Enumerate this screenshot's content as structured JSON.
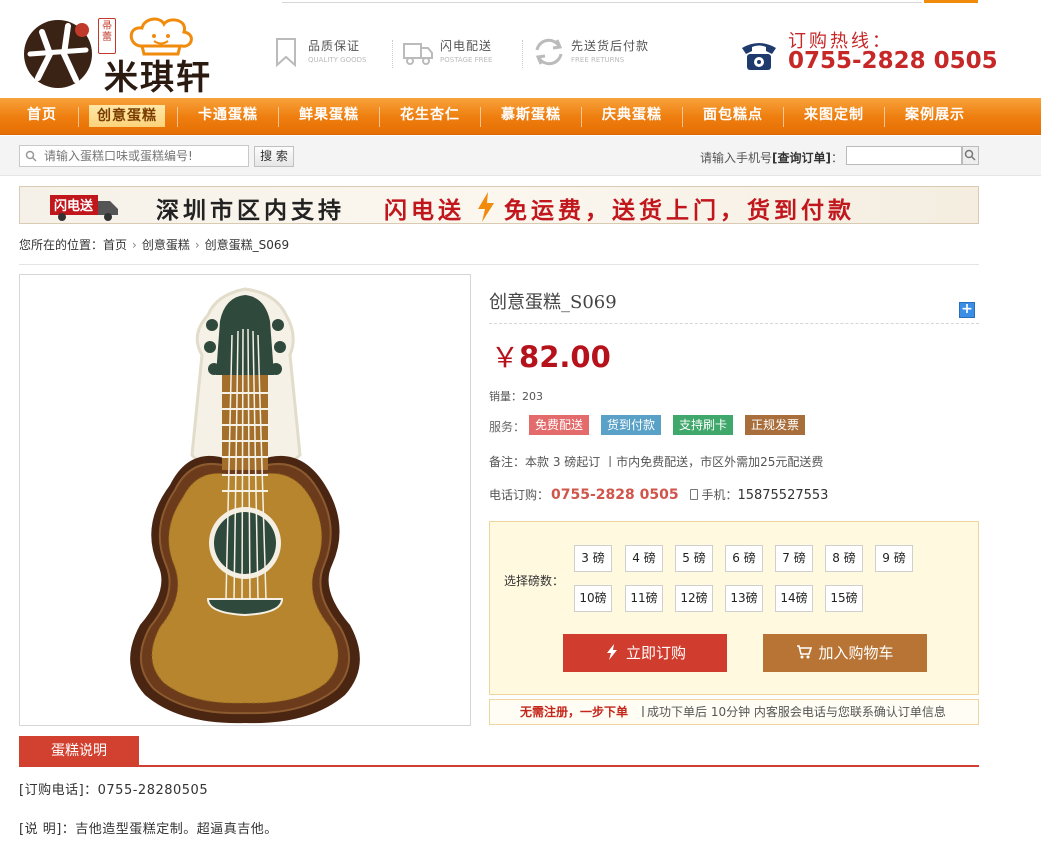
{
  "header": {
    "brand": "米琪轩",
    "brand_seal": "帚蕾",
    "promises": [
      {
        "title": "品质保证",
        "sub": "QUALITY GOODS",
        "icon": "bookmark-icon"
      },
      {
        "title": "闪电配送",
        "sub": "POSTAGE FREE",
        "icon": "truck-icon"
      },
      {
        "title": "先送货后付款",
        "sub": "FREE RETURNS",
        "icon": "return-arrows-icon"
      }
    ],
    "hotline_label": "订购热线：",
    "hotline_number": "0755-2828 0505"
  },
  "nav": {
    "items": [
      {
        "label": "首页"
      },
      {
        "label": "创意蛋糕",
        "active": true
      },
      {
        "label": "卡通蛋糕"
      },
      {
        "label": "鲜果蛋糕"
      },
      {
        "label": "花生杏仁"
      },
      {
        "label": "慕斯蛋糕"
      },
      {
        "label": "庆典蛋糕"
      },
      {
        "label": "面包糕点"
      },
      {
        "label": "来图定制"
      },
      {
        "label": "案例展示"
      }
    ]
  },
  "search": {
    "placeholder": "请输入蛋糕口味或蛋糕编号!",
    "button": "搜 索",
    "order_label": "请输入手机号",
    "order_query": "[查询订单]",
    "order_colon": "："
  },
  "banner": {
    "badge": "闪电送",
    "text1": "深圳市区内支持",
    "text2": "闪电送",
    "text3": "免运费，送货上门，货到付款"
  },
  "breadcrumb": {
    "prefix": "您所在的位置：",
    "items": [
      "首页",
      "创意蛋糕",
      "创意蛋糕_S069"
    ]
  },
  "product": {
    "title": "创意蛋糕_S069",
    "currency": "￥",
    "price": "82.00",
    "sales_label": "销量：",
    "sales": "203",
    "service_label": "服务：",
    "services": [
      "免费配送",
      "货到付款",
      "支持刷卡",
      "正规发票"
    ],
    "note": "备注：本款 3 磅起订 丨市内免费配送，市区外需加25元配送费",
    "phone_label": "电话订购：",
    "phone": "0755-2828 0505",
    "mobile_label": "手机：",
    "mobile": "15875527553",
    "weight_label": "选择磅数：",
    "weights_row1": [
      "3 磅",
      "4 磅",
      "5 磅",
      "6 磅",
      "7 磅",
      "8 磅",
      "9 磅"
    ],
    "weights_row2": [
      "10磅",
      "11磅",
      "12磅",
      "13磅",
      "14磅",
      "15磅"
    ],
    "buy_now": "立即订购",
    "add_cart": "加入购物车",
    "tip_a": "无需注册，一步下单",
    "tip_pipe": "丨",
    "tip_b": "成功下单后 10分钟 内客服会电话与您联系确认订单信息"
  },
  "description": {
    "tab": "蛋糕说明",
    "line1": "[订购电话]：0755-28280505",
    "line2": "[说 明]：吉他造型蛋糕定制。超逼真吉他。"
  },
  "colors": {
    "nav_orange": "#ee7d0e",
    "price_red": "#b5121b",
    "buy_red": "#d03c2e",
    "cart_brown": "#b87434"
  }
}
